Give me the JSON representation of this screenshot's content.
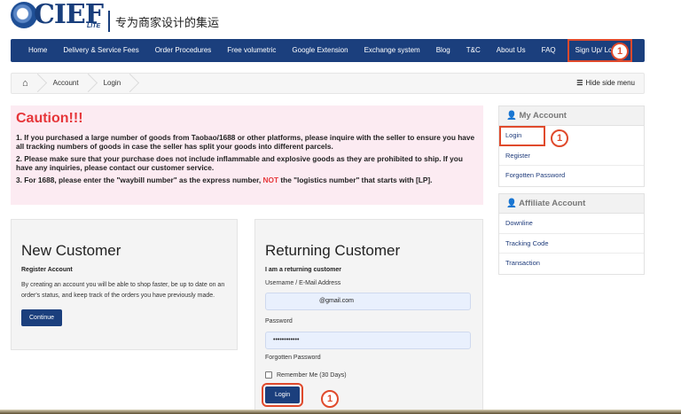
{
  "logo": {
    "mark": "CIEF",
    "lite": "LITE",
    "slogan": "专为商家设计的集运"
  },
  "nav": {
    "items": [
      "Home",
      "Delivery & Service Fees",
      "Order Procedures",
      "Free volumetric",
      "Google Extension",
      "Exchange system",
      "Blog",
      "T&C",
      "About Us",
      "FAQ",
      "Sign Up/ Log In"
    ]
  },
  "annotation": {
    "step": "1",
    "color": "#e04a2c"
  },
  "breadcrumb": {
    "items": [
      "Account",
      "Login"
    ],
    "hide_menu": "Hide side menu"
  },
  "caution": {
    "title": "Caution!!!",
    "point1": "1. If you purchased a large number of goods from Taobao/1688 or other platforms, please inquire with the seller to ensure you have all tracking numbers of goods in case the seller has split your goods into different parcels.",
    "point2": "2. Please make sure that your purchase does not include inflammable and explosive goods as they are prohibited to ship. If you have any inquiries, please contact our customer service.",
    "point3_pre": "3. For 1688, please enter the \"waybill number\" as the express number, ",
    "point3_not": "NOT",
    "point3_post": " the \"logistics number\" that starts with [LP]."
  },
  "new_customer": {
    "title": "New Customer",
    "subtitle": "Register Account",
    "description": "By creating an account you will be able to shop faster, be up to date on an order's status, and keep track of the orders you have previously made.",
    "button": "Continue"
  },
  "returning_customer": {
    "title": "Returning Customer",
    "subtitle": "I am a returning customer",
    "email_label": "Username / E-Mail Address",
    "email_value": "@gmail.com",
    "password_label": "Password",
    "password_value": "••••••••••••",
    "forgotten": "Forgotten Password",
    "remember": "Remember Me (30 Days)",
    "button": "Login"
  },
  "side_my_account": {
    "title": "My Account",
    "items": [
      "Login",
      "Register",
      "Forgotten Password"
    ]
  },
  "side_affiliate": {
    "title": "Affiliate Account",
    "items": [
      "Downline",
      "Tracking Code",
      "Transaction"
    ]
  },
  "colors": {
    "brand": "#1b3f7d",
    "caution_bg": "#fcebf2",
    "caution_red": "#e6363a",
    "highlight": "#e04a2c"
  }
}
